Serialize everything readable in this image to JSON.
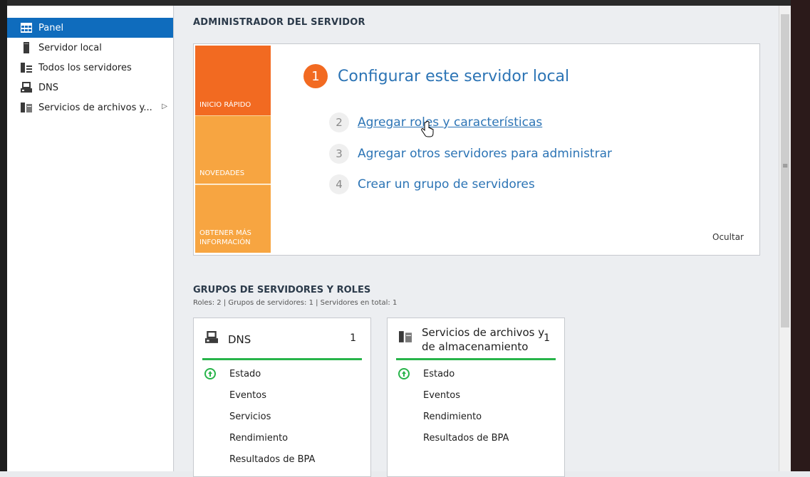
{
  "sidebar": {
    "items": [
      {
        "label": "Panel",
        "icon": "dashboard-icon",
        "active": true
      },
      {
        "label": "Servidor local",
        "icon": "server-icon",
        "active": false
      },
      {
        "label": "Todos los servidores",
        "icon": "servers-icon",
        "active": false
      },
      {
        "label": "DNS",
        "icon": "dns-icon",
        "active": false
      },
      {
        "label": "Servicios de archivos y...",
        "icon": "file-services-icon",
        "active": false
      }
    ]
  },
  "main": {
    "title": "ADMINISTRADOR DEL SERVIDOR",
    "welcome": {
      "tiles": [
        "INICIO RÁPIDO",
        "NOVEDADES",
        "OBTENER MÁS INFORMACIÓN"
      ],
      "step1": {
        "number": "1",
        "label": "Configurar este servidor local"
      },
      "steps": [
        {
          "number": "2",
          "label": "Agregar roles y características"
        },
        {
          "number": "3",
          "label": "Agregar otros servidores para administrar"
        },
        {
          "number": "4",
          "label": "Crear un grupo de servidores"
        }
      ],
      "hide": "Ocultar"
    },
    "groups": {
      "title": "GRUPOS DE SERVIDORES Y ROLES",
      "summary": "Roles: 2  |  Grupos de servidores: 1  |  Servidores en total: 1",
      "cards": [
        {
          "name": "DNS",
          "count": "1",
          "rows": [
            "Estado",
            "Eventos",
            "Servicios",
            "Rendimiento",
            "Resultados de BPA"
          ]
        },
        {
          "name_line1": "Servicios de archivos y",
          "name_line2": "de almacenamiento",
          "count": "1",
          "rows": [
            "Estado",
            "Eventos",
            "Rendimiento",
            "Resultados de BPA"
          ]
        }
      ]
    }
  },
  "colors": {
    "accent": "#0f6cbd",
    "quick_start": "#f26a21",
    "tile_orange": "#f7a541",
    "link": "#2c74b5",
    "status_green": "#28b44a"
  }
}
